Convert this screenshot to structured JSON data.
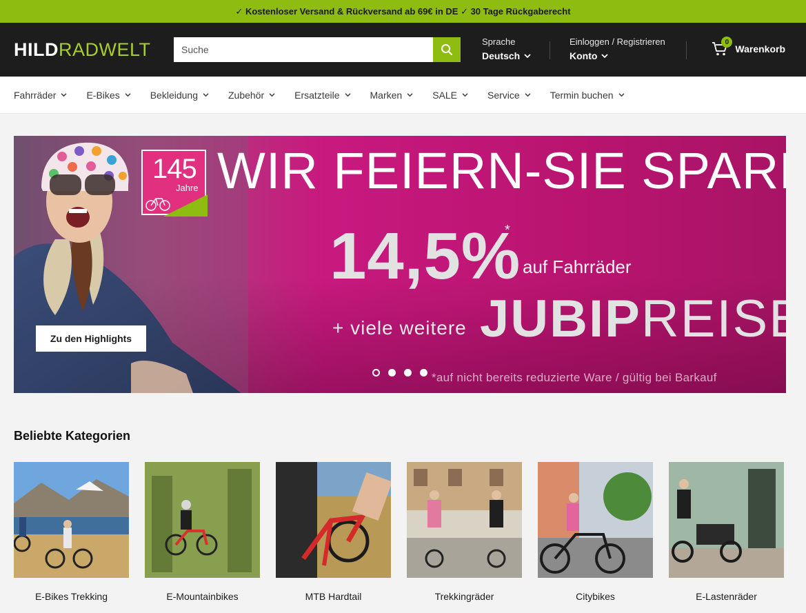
{
  "topbar": {
    "text": "✓ Kostenloser Versand & Rückversand ab 69€ in DE ✓ 30 Tage Rückgaberecht"
  },
  "header": {
    "logo_part1": "HILD",
    "logo_part2": "RADWELT",
    "search_placeholder": "Suche",
    "language_label": "Sprache",
    "language_value": "Deutsch",
    "account_label": "Einloggen / Registrieren",
    "account_value": "Konto",
    "cart_count": "0",
    "cart_label": "Warenkorb"
  },
  "nav": {
    "items": [
      {
        "label": "Fahrräder"
      },
      {
        "label": "E-Bikes"
      },
      {
        "label": "Bekleidung"
      },
      {
        "label": "Zubehör"
      },
      {
        "label": "Ersatzteile"
      },
      {
        "label": "Marken"
      },
      {
        "label": "SALE"
      },
      {
        "label": "Service"
      },
      {
        "label": "Termin buchen"
      }
    ]
  },
  "hero": {
    "badge_number": "145",
    "badge_text": "Jahre",
    "headline": "WIR FEIERN-SIE SPAREN",
    "percent": "14,5%",
    "asterisk": "*",
    "percent_suffix": "auf Fahrräder",
    "plus_text": "+ viele weitere",
    "jubi_bold": "JUBIP",
    "jubi_rest": "REISE",
    "footnote": "*auf nicht bereits reduzierte Ware / gültig bei Barkauf",
    "button_label": "Zu den Highlights",
    "slide_count": 4,
    "active_slide": 1
  },
  "categories": {
    "title": "Beliebte Kategorien",
    "items": [
      {
        "label": "E-Bikes Trekking"
      },
      {
        "label": "E-Mountainbikes"
      },
      {
        "label": "MTB Hardtail"
      },
      {
        "label": "Trekkingräder"
      },
      {
        "label": "Citybikes"
      },
      {
        "label": "E-Lastenräder"
      }
    ]
  },
  "colors": {
    "brand_green": "#8fbc10",
    "header_dark": "#1d1d1d",
    "hero_magenta": "#c8197f"
  }
}
